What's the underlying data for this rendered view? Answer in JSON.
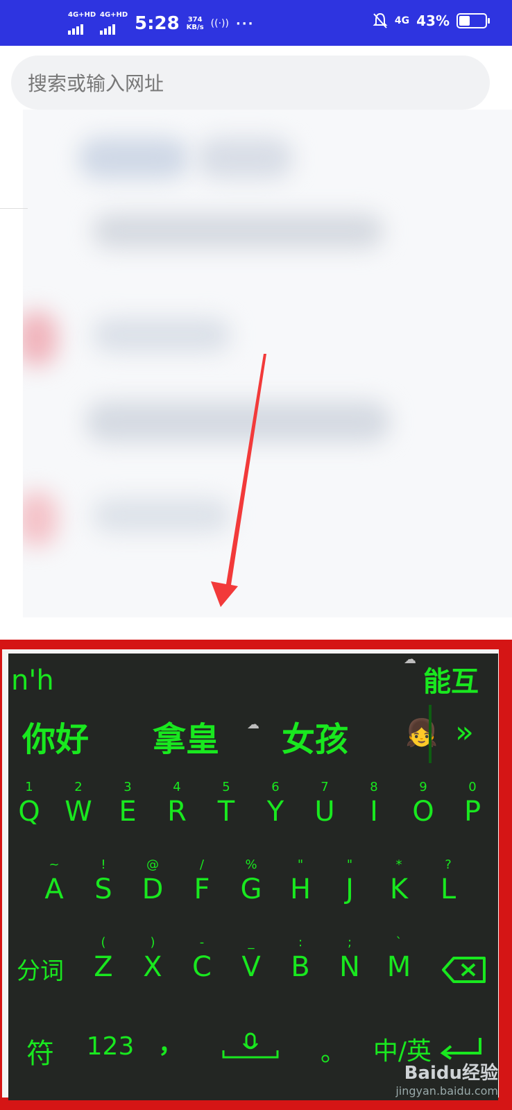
{
  "status_bar": {
    "sim1_label": "4G+HD",
    "sim2_label": "4G+HD",
    "time": "5:28",
    "net_speed_value": "374",
    "net_speed_unit": "KB/s",
    "hotspot_icon": "hotspot-icon",
    "more_dots": "···",
    "network": "4G",
    "battery_text": "43%",
    "battery_level": 0.43
  },
  "search": {
    "placeholder": "搜索或输入网址"
  },
  "keyboard": {
    "composing": "n'h",
    "cloud_suggestion": "能互",
    "candidates": [
      "你好",
      "拿皇",
      "女孩"
    ],
    "emoji_candidate": "👧",
    "more_candidates_icon": "»",
    "row1": [
      {
        "sub": "1",
        "key": "Q"
      },
      {
        "sub": "2",
        "key": "W"
      },
      {
        "sub": "3",
        "key": "E"
      },
      {
        "sub": "4",
        "key": "R"
      },
      {
        "sub": "5",
        "key": "T"
      },
      {
        "sub": "6",
        "key": "Y"
      },
      {
        "sub": "7",
        "key": "U"
      },
      {
        "sub": "8",
        "key": "I"
      },
      {
        "sub": "9",
        "key": "O"
      },
      {
        "sub": "0",
        "key": "P"
      }
    ],
    "row2": [
      {
        "sub": "~",
        "key": "A"
      },
      {
        "sub": "!",
        "key": "S"
      },
      {
        "sub": "@",
        "key": "D"
      },
      {
        "sub": "/",
        "key": "F"
      },
      {
        "sub": "%",
        "key": "G"
      },
      {
        "sub": "\"",
        "key": "H"
      },
      {
        "sub": "\"",
        "key": "J"
      },
      {
        "sub": "*",
        "key": "K"
      },
      {
        "sub": "?",
        "key": "L"
      }
    ],
    "row3_left": "分词",
    "row3": [
      {
        "sub": "(",
        "key": "Z"
      },
      {
        "sub": ")",
        "key": "X"
      },
      {
        "sub": "-",
        "key": "C"
      },
      {
        "sub": "_",
        "key": "V"
      },
      {
        "sub": ":",
        "key": "B"
      },
      {
        "sub": ";",
        "key": "N"
      },
      {
        "sub": "`",
        "key": "M"
      }
    ],
    "symbols_label": "符",
    "numbers_label": "123",
    "comma_label": "，",
    "period_label": "。",
    "lang_label": "中/英",
    "enter_icon": "enter-icon"
  },
  "watermark": {
    "brand": "Baidu经验",
    "url": "jingyan.baidu.com"
  },
  "colors": {
    "status_bar": "#2e34e0",
    "key_green": "#19e81f",
    "keyboard_bg": "#232623",
    "frame_red": "#d51515"
  }
}
